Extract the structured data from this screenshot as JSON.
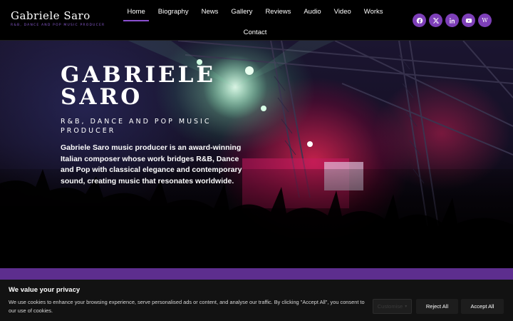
{
  "header": {
    "logo_name": "Gabriele Saro",
    "logo_tagline": "R&B, DANCE AND POP MUSIC PRODUCER",
    "nav": [
      {
        "label": "Home",
        "active": true
      },
      {
        "label": "Biography"
      },
      {
        "label": "News"
      },
      {
        "label": "Gallery"
      },
      {
        "label": "Reviews"
      },
      {
        "label": "Audio"
      },
      {
        "label": "Video"
      },
      {
        "label": "Works"
      },
      {
        "label": "Contact"
      }
    ],
    "social": [
      {
        "icon": "facebook-icon"
      },
      {
        "icon": "x-icon"
      },
      {
        "icon": "linkedin-icon"
      },
      {
        "icon": "youtube-icon"
      },
      {
        "icon": "wikipedia-icon",
        "glyph": "W"
      }
    ]
  },
  "hero": {
    "title_line1": "GABRIELE",
    "title_line2": "SARO",
    "subtitle_line1": "R&B, DANCE AND POP MUSIC",
    "subtitle_line2": "PRODUCER",
    "description": "Gabriele Saro music producer is an award-winning Italian composer whose work bridges R&B, Dance and Pop with classical elegance and contemporary sound, creating music that resonates worldwide."
  },
  "cookie": {
    "title": "We value your privacy",
    "text": "We use cookies to enhance your browsing experience, serve personalised ads or content, and analyse our traffic. By clicking \"Accept All\", you consent to our use of cookies.",
    "customise_label": "Customise",
    "reject_label": "Reject All",
    "accept_label": "Accept All"
  },
  "colors": {
    "accent": "#7d3fb8",
    "band": "#5d2e8e",
    "cookie_bg": "#121212"
  }
}
